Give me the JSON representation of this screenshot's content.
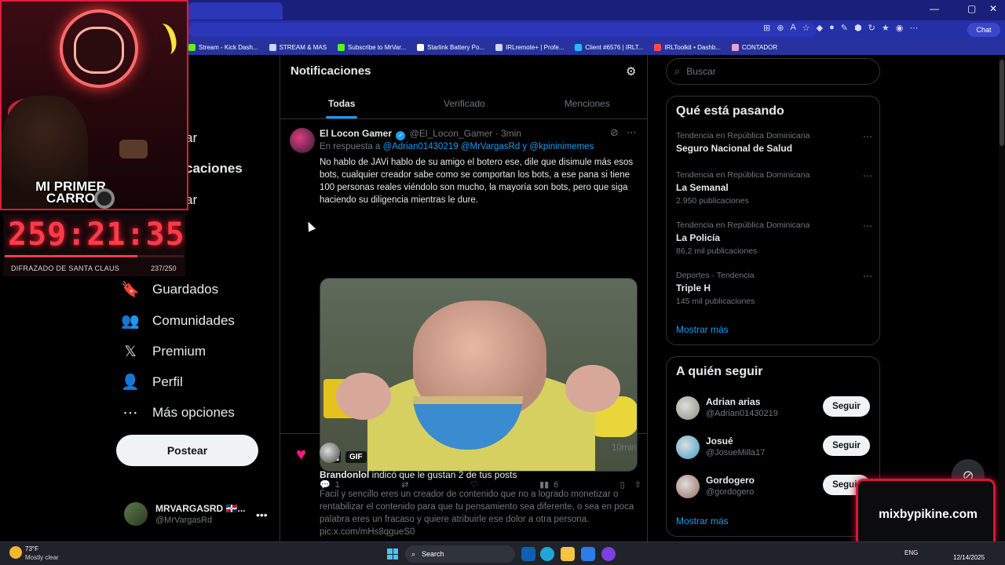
{
  "browser": {
    "bookmarks": [
      {
        "label": "Stream - Kick Dash...",
        "color": "#53fc18"
      },
      {
        "label": "STREAM & MAS",
        "color": "#cfd3ff"
      },
      {
        "label": "Subscribe to MrVar...",
        "color": "#53fc18"
      },
      {
        "label": "Starlink Battery Po...",
        "color": "#ffffff"
      },
      {
        "label": "IRLremote+ | Profe...",
        "color": "#cfd3ff"
      },
      {
        "label": "Client #6576 | IRLT...",
        "color": "#2fb5ff"
      },
      {
        "label": "IRLToolkit • Dashb...",
        "color": "#ff4a4a"
      },
      {
        "label": "CONTADOR",
        "color": "#f0a0c0"
      }
    ],
    "chat_label": "Chat"
  },
  "overlay": {
    "car_text": "MI PRIMER CARRO",
    "timer": "259:21:35",
    "progress_fraction": 0.74,
    "costume_label": "DIFRAZADO DE SANTA CLAUS",
    "costume_count": "237/250",
    "brand": "mixbypikine.com"
  },
  "nav": {
    "partial": [
      "ar",
      "caciones",
      "ar"
    ],
    "items": [
      {
        "label": "Guardados",
        "icon": "bookmark-icon",
        "glyph": "🔖"
      },
      {
        "label": "Comunidades",
        "icon": "communities-icon",
        "glyph": "👥"
      },
      {
        "label": "Premium",
        "icon": "x-logo-icon",
        "glyph": "𝕏"
      },
      {
        "label": "Perfil",
        "icon": "profile-icon",
        "glyph": "👤"
      },
      {
        "label": "Más opciones",
        "icon": "more-options-icon",
        "glyph": "⋯"
      }
    ],
    "post_button": "Postear",
    "me": {
      "name": "MRVARGASRD 🇩🇴...",
      "handle": "@MrVargasRd"
    }
  },
  "main": {
    "title": "Notificaciones",
    "tabs": [
      "Todas",
      "Verificado",
      "Menciones"
    ],
    "post": {
      "name": "El Locon Gamer",
      "handle": "@El_Locon_Gamer",
      "time": "· 3min",
      "reply_prefix": "En respuesta a",
      "mentions": "@Adrian01430219 @MrVargasRd y @kpininimemes",
      "text": "No hablo de JAVi hablo de su amigo el botero ese, dile que disimule más esos bots, cualquier creador sabe como se comportan los bots, a ese pana si tiene 100 personas reales viéndolo son mucho, la mayoría son bots, pero que siga haciendo su diligencia mientras le dure.",
      "gif_label": "GIF",
      "replies": "1",
      "views": "6"
    },
    "notification": {
      "time": "10min",
      "user": "Brandonlol",
      "action": "indicó que le gustan 2 de tus posts",
      "body": "Facil y sencillo eres un creador de contenido que no a logrado monetizar o rentabilizar el contenido para que tu pensamiento sea diferente, o sea en poca palabra eres un fracaso y quiere atribuirle ese dolor a otra persona. pic.x.com/mHs8qgueS0"
    }
  },
  "right": {
    "search_placeholder": "Buscar",
    "trends_title": "Qué está pasando",
    "trends": [
      {
        "context": "Tendencia en República Dominicana",
        "name": "Seguro Nacional de Salud",
        "count": ""
      },
      {
        "context": "Tendencia en República Dominicana",
        "name": "La Semanal",
        "count": "2.950 publicaciones"
      },
      {
        "context": "Tendencia en República Dominicana",
        "name": "La Policía",
        "count": "86,2 mil publicaciones"
      },
      {
        "context": "Deportes · Tendencia",
        "name": "Triple H",
        "count": "145 mil publicaciones"
      }
    ],
    "show_more": "Mostrar más",
    "follow_title": "A quién seguir",
    "follow": [
      {
        "name": "Adrian arias",
        "handle": "@Adrian01430219",
        "button": "Seguir",
        "color": "#8a8f7a"
      },
      {
        "name": "Josué",
        "handle": "@JosueMilla17",
        "button": "Seguir",
        "color": "#3aa0c8"
      },
      {
        "name": "Gordogero",
        "handle": "@gordogero",
        "button": "Seguir",
        "color": "#9a6a5a"
      }
    ],
    "follow_show_more": "Mostrar más"
  },
  "taskbar": {
    "temp": "73°F",
    "weather": "Mostly clear",
    "search": "Search",
    "lang": "ENG",
    "date": "12/14/2025"
  }
}
